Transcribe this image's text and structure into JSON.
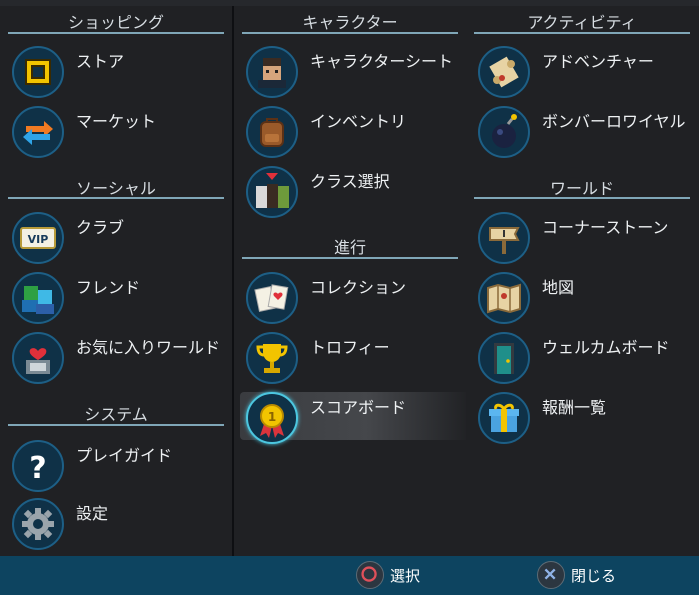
{
  "columns": [
    {
      "sections": [
        {
          "title": "ショッピング",
          "items": [
            {
              "label": "ストア",
              "icon": "store-icon"
            },
            {
              "label": "マーケット",
              "icon": "market-icon"
            }
          ]
        },
        {
          "title": "ソーシャル",
          "items": [
            {
              "label": "クラブ",
              "icon": "vip-club-icon"
            },
            {
              "label": "フレンド",
              "icon": "friends-icon"
            },
            {
              "label": "お気に入りワールド",
              "icon": "favorite-worlds-icon"
            }
          ]
        },
        {
          "title": "システム",
          "items": [
            {
              "label": "プレイガイド",
              "icon": "question-icon"
            },
            {
              "label": "設定",
              "icon": "gear-icon"
            }
          ]
        }
      ]
    },
    {
      "sections": [
        {
          "title": "キャラクター",
          "items": [
            {
              "label": "キャラクターシート",
              "icon": "character-sheet-icon"
            },
            {
              "label": "インベントリ",
              "icon": "backpack-icon"
            },
            {
              "label": "クラス選択",
              "icon": "class-select-icon"
            }
          ]
        },
        {
          "title": "進行",
          "items": [
            {
              "label": "コレクション",
              "icon": "cards-icon"
            },
            {
              "label": "トロフィー",
              "icon": "trophy-icon"
            },
            {
              "label": "スコアボード",
              "icon": "medal-icon"
            }
          ]
        }
      ]
    },
    {
      "sections": [
        {
          "title": "アクティビティ",
          "items": [
            {
              "label": "アドベンチャー",
              "icon": "scroll-icon"
            },
            {
              "label": "ボンバーロワイヤル",
              "icon": "bomb-icon"
            }
          ]
        },
        {
          "title": "ワールド",
          "items": [
            {
              "label": "コーナーストーン",
              "icon": "cornerstone-sign-icon"
            },
            {
              "label": "地図",
              "icon": "map-icon"
            },
            {
              "label": "ウェルカムボード",
              "icon": "door-icon"
            },
            {
              "label": "報酬一覧",
              "icon": "gift-icon"
            }
          ]
        }
      ]
    }
  ],
  "selected": "スコアボード",
  "footer": {
    "select_label": "選択",
    "close_label": "閉じる",
    "select_icon": "circle-button-icon",
    "close_icon": "cross-button-icon"
  },
  "colors": {
    "accent": "#7fa6b7",
    "footer": "#0d4460",
    "panel": "#202124",
    "icon_bg": "#0f3147"
  }
}
